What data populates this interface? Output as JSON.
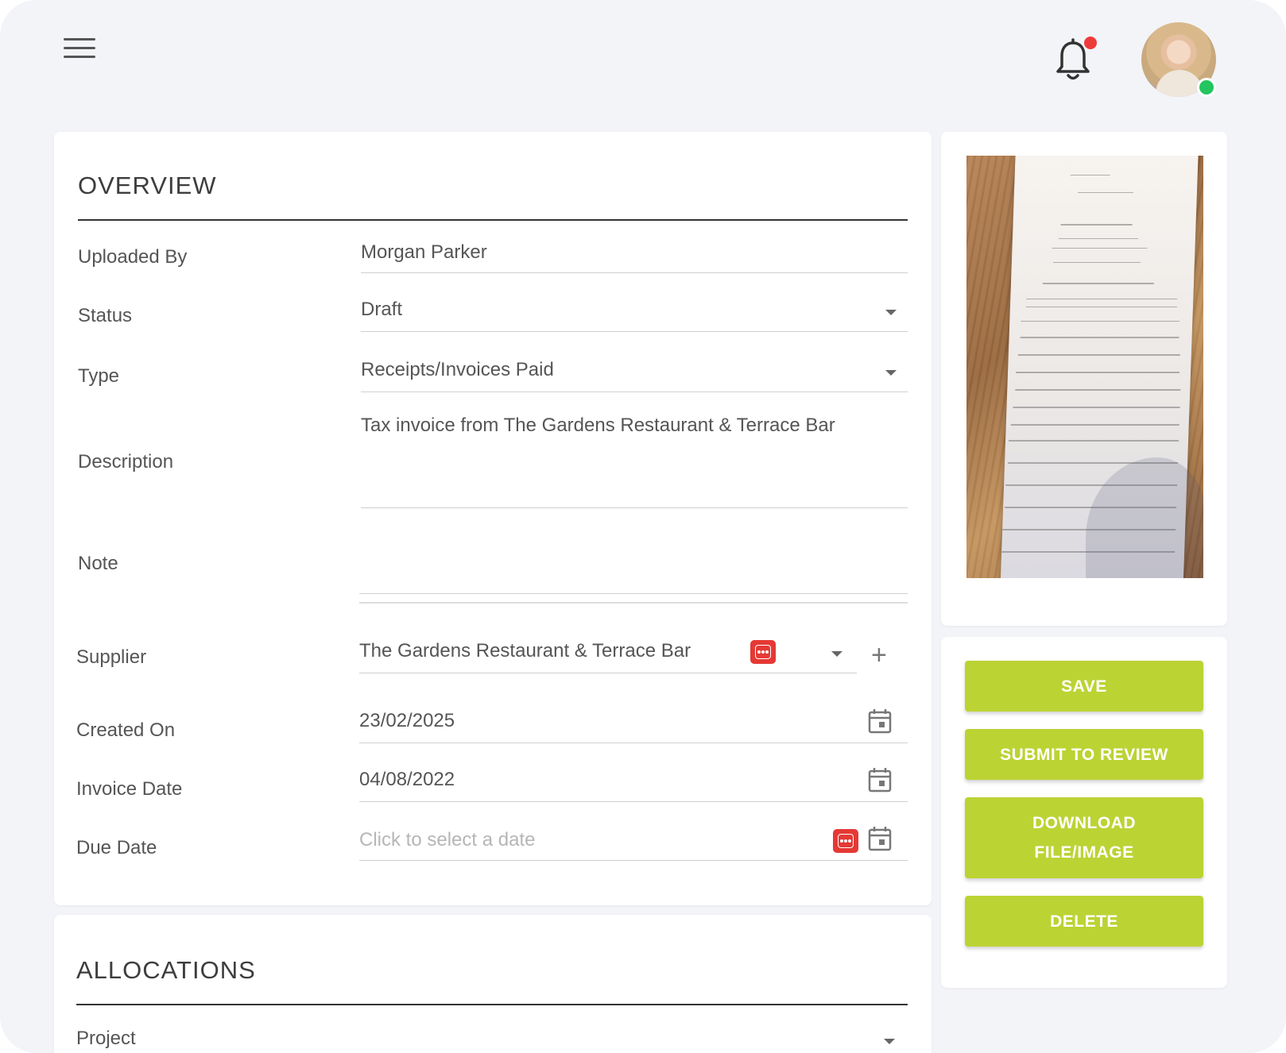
{
  "header": {
    "menu_icon": "hamburger-menu-icon",
    "notification_icon": "bell-icon",
    "notification_badge_color": "#ef3a3a",
    "online_status_color": "#22c55e"
  },
  "overview": {
    "title": "OVERVIEW",
    "uploaded_by": {
      "label": "Uploaded By",
      "value": "Morgan Parker"
    },
    "status": {
      "label": "Status",
      "value": "Draft"
    },
    "type": {
      "label": "Type",
      "value": "Receipts/Invoices Paid"
    },
    "description": {
      "label": "Description",
      "value": "Tax invoice from The Gardens Restaurant & Terrace Bar"
    },
    "note": {
      "label": "Note",
      "value": ""
    },
    "supplier": {
      "label": "Supplier",
      "value": "The Gardens Restaurant & Terrace Bar"
    },
    "created_on": {
      "label": "Created On",
      "value": "23/02/2025"
    },
    "invoice_date": {
      "label": "Invoice Date",
      "value": "04/08/2022"
    },
    "due_date": {
      "label": "Due Date",
      "placeholder": "Click to select a date"
    }
  },
  "allocations": {
    "title": "ALLOCATIONS",
    "project": {
      "label": "Project"
    }
  },
  "actions": {
    "save": "SAVE",
    "submit": "SUBMIT TO REVIEW",
    "download_line1": "DOWNLOAD",
    "download_line2": "FILE/IMAGE",
    "delete": "DELETE",
    "accent_color": "#bcd334"
  }
}
